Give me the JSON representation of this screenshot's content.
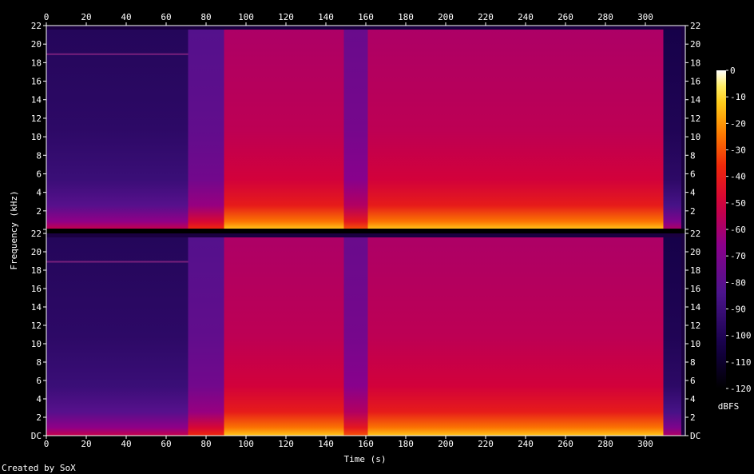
{
  "chart_data": {
    "type": "heatmap",
    "title": "",
    "xlabel": "Time (s)",
    "ylabel": "Frequency (kHz)",
    "xlim": [
      0,
      320
    ],
    "ylim": [
      0,
      22
    ],
    "x_ticks": [
      0,
      20,
      40,
      60,
      80,
      100,
      120,
      140,
      160,
      180,
      200,
      220,
      240,
      260,
      280,
      300
    ],
    "y_ticks": [
      "DC",
      "2",
      "4",
      "6",
      "8",
      "10",
      "12",
      "14",
      "16",
      "18",
      "20",
      "22"
    ],
    "channels": 2,
    "colorbar": {
      "label": "dBFS",
      "range": [
        -120,
        0
      ],
      "ticks": [
        "0",
        "-10",
        "-20",
        "-30",
        "-40",
        "-50",
        "-60",
        "-70",
        "-80",
        "-90",
        "-100",
        "-110",
        "-120"
      ]
    },
    "segments": [
      {
        "start": 0,
        "end": 71,
        "level_db": -95
      },
      {
        "start": 71,
        "end": 89,
        "level_db": -78
      },
      {
        "start": 89,
        "end": 149,
        "level_db": -55
      },
      {
        "start": 149,
        "end": 161,
        "level_db": -72
      },
      {
        "start": 161,
        "end": 309,
        "level_db": -55
      },
      {
        "start": 309,
        "end": 318,
        "level_db": -100
      }
    ],
    "grid": false,
    "legend": "right"
  },
  "footer": {
    "credit": "Created by SoX"
  }
}
